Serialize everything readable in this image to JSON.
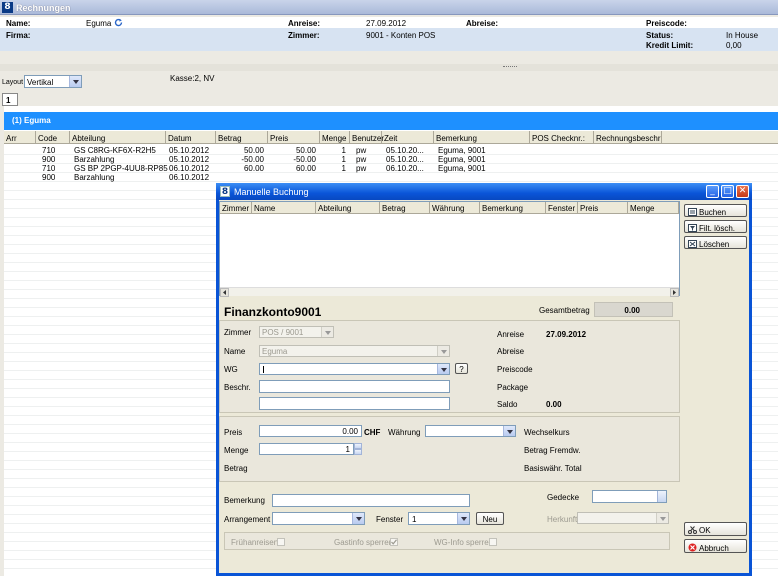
{
  "window": {
    "title": "Rechnungen"
  },
  "header": {
    "name_label": "Name:",
    "name_value": "Eguma",
    "firma_label": "Firma:",
    "anreise_label": "Anreise:",
    "anreise_value": "27.09.2012",
    "abreise_label": "Abreise:",
    "zimmer_label": "Zimmer:",
    "zimmer_value": "9001 - Konten POS",
    "preiscode_label": "Preiscode:",
    "status_label": "Status:",
    "status_value": "In House",
    "kredit_label": "Kredit Limit:",
    "kredit_value": "0,00"
  },
  "toolbar": {
    "layout_label": "Layout",
    "layout_value": "Vertikal",
    "kasse": "Kasse:2, NV",
    "tab": "1"
  },
  "group": {
    "label": "(1)  Eguma"
  },
  "columns": [
    "Arr",
    "Code",
    "Abteilung",
    "Datum",
    "Betrag",
    "Preis",
    "Menge",
    "Benutzer",
    "Zeit",
    "Bemerkung",
    "POS Checknr.:",
    "Rechnungsbeschr"
  ],
  "rows": [
    {
      "code": "710",
      "abteilung": "GS C8RG-KF6X-R2H5",
      "datum": "05.10.2012",
      "betrag": "50.00",
      "preis": "50.00",
      "menge": "1",
      "benutzer": "pw",
      "zeit": "05.10.20...",
      "bemerkung": "Eguma, 9001"
    },
    {
      "code": "900",
      "abteilung": "Barzahlung",
      "datum": "05.10.2012",
      "betrag": "-50.00",
      "preis": "-50.00",
      "menge": "1",
      "benutzer": "pw",
      "zeit": "05.10.20...",
      "bemerkung": "Eguma, 9001"
    },
    {
      "code": "710",
      "abteilung": "GS BP 2PGP-4UU8-RP85",
      "datum": "06.10.2012",
      "betrag": "60.00",
      "preis": "60.00",
      "menge": "1",
      "benutzer": "pw",
      "zeit": "06.10.20...",
      "bemerkung": "Eguma, 9001"
    },
    {
      "code": "900",
      "abteilung": "Barzahlung",
      "datum": "06.10.2012",
      "betrag": "",
      "preis": "",
      "menge": "",
      "benutzer": "",
      "zeit": "",
      "bemerkung": ""
    }
  ],
  "dialog": {
    "title": "Manuelle Buchung",
    "columns": [
      "Zimmer",
      "Name",
      "Abteilung",
      "Betrag",
      "Währung",
      "Bemerkung",
      "Fenster",
      "Preis",
      "Menge"
    ],
    "buttons": {
      "buchen": "Buchen",
      "filt": "Filt. lösch.",
      "loeschen": "Löschen",
      "ok": "OK",
      "abbruch": "Abbruch"
    },
    "konto": "Finanzkonto9001",
    "gesamtbetrag_label": "Gesamtbetrag",
    "gesamtbetrag_value": "0.00",
    "zimmer_label": "Zimmer",
    "zimmer_value": "POS / 9001",
    "name_label": "Name",
    "name_value": "Eguma",
    "wg_label": "WG",
    "wg_help": "?",
    "beschr_label": "Beschr.",
    "anreise_label": "Anreise",
    "anreise_value": "27.09.2012",
    "abreise_label": "Abreise",
    "preiscode_label": "Preiscode",
    "package_label": "Package",
    "saldo_label": "Saldo",
    "saldo_value": "0.00",
    "preis_label": "Preis",
    "preis_value": "0.00",
    "currency": "CHF",
    "waehrung_label": "Währung",
    "wechselkurs_label": "Wechselkurs",
    "menge_label": "Menge",
    "menge_value": "1",
    "betrag_fremdw_label": "Betrag Fremdw.",
    "betrag_label": "Betrag",
    "basis_label": "Basiswähr. Total",
    "bemerkung_label": "Bemerkung",
    "gedecke_label": "Gedecke",
    "arrangement_label": "Arrangement",
    "fenster_label": "Fenster",
    "fenster_value": "1",
    "neu_label": "Neu",
    "herkunft_label": "Herkunft",
    "fruehanreisen_label": "Frühanreisen",
    "gastinfo_label": "Gastinfo sperren",
    "wginfo_label": "WG-Info sperren"
  },
  "colors": {
    "title_blue": "#0a55d8",
    "group_blue": "#1e90ff",
    "header_band": "#d7e3f2"
  }
}
